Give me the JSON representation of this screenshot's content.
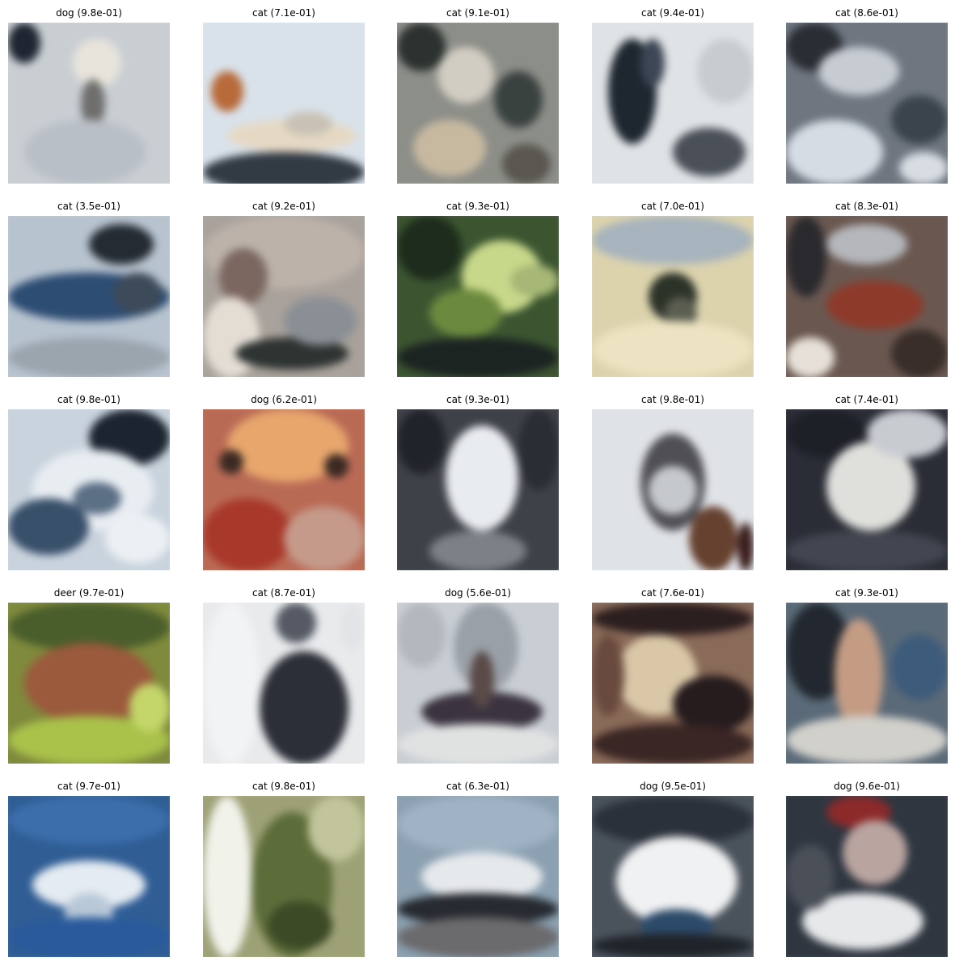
{
  "grid": {
    "rows": 5,
    "cols": 5,
    "images": [
      {
        "label": "dog (9.8e-01)",
        "bg": "#c9ced3",
        "blobs": [
          [
            "#1f2632",
            0,
            0,
            40,
            50
          ],
          [
            "#e8e4dc",
            80,
            20,
            60,
            60
          ],
          [
            "#6e6f6c",
            90,
            70,
            30,
            60
          ],
          [
            "#b9bfc6",
            20,
            120,
            150,
            80
          ]
        ]
      },
      {
        "label": "cat (7.1e-01)",
        "bg": "#d9e2ea",
        "blobs": [
          [
            "#b86a3a",
            10,
            60,
            40,
            50
          ],
          [
            "#e6d9c4",
            30,
            120,
            160,
            40
          ],
          [
            "#323a44",
            0,
            160,
            200,
            50
          ],
          [
            "#c9c2b4",
            100,
            110,
            60,
            30
          ]
        ]
      },
      {
        "label": "cat (9.1e-01)",
        "bg": "#8c8e88",
        "blobs": [
          [
            "#2c3230",
            0,
            0,
            60,
            60
          ],
          [
            "#d2cdc2",
            50,
            30,
            70,
            70
          ],
          [
            "#3a4240",
            120,
            60,
            60,
            70
          ],
          [
            "#c7b9a0",
            20,
            120,
            90,
            70
          ],
          [
            "#5a5650",
            130,
            150,
            60,
            50
          ]
        ]
      },
      {
        "label": "cat (9.4e-01)",
        "bg": "#dfe3e6",
        "blobs": [
          [
            "#1e2630",
            20,
            20,
            60,
            130
          ],
          [
            "#3c4654",
            60,
            20,
            30,
            60
          ],
          [
            "#4a4f58",
            100,
            130,
            90,
            60
          ],
          [
            "#c8ccd0",
            130,
            20,
            70,
            80
          ]
        ]
      },
      {
        "label": "cat (8.6e-01)",
        "bg": "#6f7680",
        "blobs": [
          [
            "#2a2e34",
            0,
            0,
            70,
            60
          ],
          [
            "#c7ccd3",
            40,
            30,
            100,
            60
          ],
          [
            "#d5dce4",
            0,
            120,
            120,
            80
          ],
          [
            "#3b434d",
            130,
            90,
            70,
            60
          ],
          [
            "#d8dde3",
            140,
            160,
            60,
            40
          ]
        ]
      },
      {
        "label": "cat (3.5e-01)",
        "bg": "#b7c3cf",
        "blobs": [
          [
            "#252b33",
            100,
            10,
            80,
            50
          ],
          [
            "#2e4d73",
            0,
            70,
            200,
            60
          ],
          [
            "#3d4a59",
            130,
            70,
            60,
            50
          ],
          [
            "#9aa5ae",
            0,
            150,
            200,
            50
          ]
        ]
      },
      {
        "label": "cat (9.2e-01)",
        "bg": "#a9a19b",
        "blobs": [
          [
            "#bcb2aa",
            0,
            0,
            200,
            90
          ],
          [
            "#7b6760",
            20,
            40,
            60,
            70
          ],
          [
            "#e3ddd4",
            0,
            100,
            70,
            100
          ],
          [
            "#2e3432",
            40,
            150,
            140,
            40
          ],
          [
            "#8a8f95",
            100,
            100,
            90,
            60
          ]
        ]
      },
      {
        "label": "cat (9.3e-01)",
        "bg": "#3c5530",
        "blobs": [
          [
            "#1d2c1c",
            0,
            0,
            80,
            80
          ],
          [
            "#c8d88a",
            80,
            30,
            100,
            90
          ],
          [
            "#6c8a3e",
            40,
            90,
            90,
            60
          ],
          [
            "#1c2422",
            0,
            150,
            200,
            50
          ],
          [
            "#a6b776",
            140,
            60,
            60,
            40
          ]
        ]
      },
      {
        "label": "cat (7.0e-01)",
        "bg": "#dcd3ad",
        "blobs": [
          [
            "#a7b4bd",
            0,
            0,
            200,
            60
          ],
          [
            "#2b3328",
            70,
            70,
            60,
            60
          ],
          [
            "#5b5e50",
            90,
            100,
            40,
            40
          ],
          [
            "#ebe3c1",
            0,
            130,
            200,
            70
          ]
        ]
      },
      {
        "label": "cat (8.3e-01)",
        "bg": "#6a5850",
        "blobs": [
          [
            "#2a2a2e",
            0,
            0,
            50,
            100
          ],
          [
            "#b5b7bc",
            50,
            10,
            100,
            50
          ],
          [
            "#8e3a2a",
            50,
            80,
            120,
            60
          ],
          [
            "#e6e0d8",
            0,
            150,
            60,
            50
          ],
          [
            "#3a2e2a",
            130,
            140,
            70,
            60
          ]
        ]
      },
      {
        "label": "cat (9.8e-01)",
        "bg": "#c9d3dd",
        "blobs": [
          [
            "#1c2430",
            100,
            0,
            100,
            70
          ],
          [
            "#e8edf2",
            30,
            50,
            150,
            100
          ],
          [
            "#39506b",
            0,
            110,
            100,
            70
          ],
          [
            "#5b6f85",
            80,
            90,
            60,
            40
          ],
          [
            "#ecf0f4",
            120,
            130,
            80,
            60
          ]
        ]
      },
      {
        "label": "dog (6.2e-01)",
        "bg": "#b96a55",
        "blobs": [
          [
            "#e7a66c",
            30,
            0,
            150,
            90
          ],
          [
            "#3b2a22",
            20,
            50,
            30,
            30
          ],
          [
            "#3b2a22",
            150,
            55,
            30,
            30
          ],
          [
            "#a8382a",
            0,
            110,
            110,
            90
          ],
          [
            "#c59a8a",
            100,
            120,
            100,
            80
          ]
        ]
      },
      {
        "label": "cat (9.3e-01)",
        "bg": "#3e4148",
        "blobs": [
          [
            "#21232a",
            0,
            0,
            60,
            80
          ],
          [
            "#e9ecef",
            60,
            20,
            90,
            130
          ],
          [
            "#2a2d34",
            150,
            0,
            50,
            100
          ],
          [
            "#7d8187",
            40,
            150,
            120,
            50
          ]
        ]
      },
      {
        "label": "cat (9.8e-01)",
        "bg": "#dfe2e6",
        "blobs": [
          [
            "#4f4f55",
            60,
            30,
            80,
            120
          ],
          [
            "#c5c8cc",
            70,
            70,
            60,
            60
          ],
          [
            "#66412f",
            120,
            120,
            60,
            80
          ],
          [
            "#3a1c1c",
            180,
            140,
            20,
            60
          ]
        ]
      },
      {
        "label": "cat (7.4e-01)",
        "bg": "#2a2d36",
        "blobs": [
          [
            "#1e2028",
            0,
            0,
            100,
            60
          ],
          [
            "#dfe0dc",
            50,
            40,
            110,
            110
          ],
          [
            "#c8ccd1",
            100,
            0,
            100,
            60
          ],
          [
            "#424650",
            0,
            150,
            200,
            50
          ]
        ]
      },
      {
        "label": "deer (9.7e-01)",
        "bg": "#7f8a3c",
        "blobs": [
          [
            "#4a5e2c",
            0,
            0,
            200,
            60
          ],
          [
            "#9b5a3c",
            20,
            50,
            160,
            100
          ],
          [
            "#a9c24a",
            0,
            140,
            200,
            60
          ],
          [
            "#c4d56a",
            150,
            100,
            50,
            60
          ]
        ]
      },
      {
        "label": "cat (8.7e-01)",
        "bg": "#e8eaec",
        "blobs": [
          [
            "#2c2f38",
            70,
            60,
            110,
            140
          ],
          [
            "#555a64",
            90,
            0,
            50,
            50
          ],
          [
            "#f2f3f4",
            0,
            0,
            70,
            200
          ],
          [
            "#e2e4e7",
            170,
            0,
            30,
            60
          ]
        ]
      },
      {
        "label": "dog (5.6e-01)",
        "bg": "#c9ced4",
        "blobs": [
          [
            "#9aa0a8",
            70,
            0,
            80,
            110
          ],
          [
            "#3b3440",
            30,
            110,
            150,
            50
          ],
          [
            "#5a4a48",
            90,
            60,
            30,
            70
          ],
          [
            "#e0e2e2",
            0,
            150,
            200,
            50
          ],
          [
            "#b3b8be",
            0,
            0,
            60,
            80
          ]
        ]
      },
      {
        "label": "cat (7.6e-01)",
        "bg": "#8a6a58",
        "blobs": [
          [
            "#2c1f1f",
            0,
            0,
            200,
            40
          ],
          [
            "#d9c7a7",
            30,
            40,
            100,
            100
          ],
          [
            "#261c1e",
            100,
            90,
            100,
            70
          ],
          [
            "#3a2624",
            0,
            150,
            200,
            50
          ],
          [
            "#6a4a3e",
            0,
            40,
            40,
            100
          ]
        ]
      },
      {
        "label": "cat (9.3e-01)",
        "bg": "#5a6a78",
        "blobs": [
          [
            "#232830",
            0,
            0,
            80,
            120
          ],
          [
            "#c49c84",
            60,
            20,
            60,
            140
          ],
          [
            "#3d5b7b",
            130,
            40,
            70,
            80
          ],
          [
            "#d1d0cb",
            0,
            140,
            200,
            60
          ]
        ]
      },
      {
        "label": "cat (9.7e-01)",
        "bg": "#2f5d94",
        "blobs": [
          [
            "#3c6eab",
            0,
            0,
            200,
            60
          ],
          [
            "#e4ebf2",
            30,
            80,
            140,
            60
          ],
          [
            "#b9c8d8",
            70,
            120,
            60,
            50
          ],
          [
            "#2a5a9c",
            0,
            150,
            200,
            50
          ]
        ]
      },
      {
        "label": "cat (9.8e-01)",
        "bg": "#9ea176",
        "blobs": [
          [
            "#f1f2ea",
            0,
            0,
            60,
            200
          ],
          [
            "#5d6d3a",
            60,
            20,
            100,
            180
          ],
          [
            "#c2c59b",
            130,
            0,
            70,
            80
          ],
          [
            "#3d4a26",
            80,
            130,
            80,
            60
          ]
        ]
      },
      {
        "label": "cat (6.3e-01)",
        "bg": "#8ba0b1",
        "blobs": [
          [
            "#9fb3c4",
            0,
            0,
            200,
            70
          ],
          [
            "#e6e9ec",
            30,
            70,
            150,
            60
          ],
          [
            "#272b31",
            0,
            120,
            200,
            40
          ],
          [
            "#6b6a6c",
            0,
            150,
            200,
            50
          ]
        ]
      },
      {
        "label": "dog (9.5e-01)",
        "bg": "#4a525c",
        "blobs": [
          [
            "#2b313a",
            0,
            0,
            200,
            60
          ],
          [
            "#f0f1f2",
            30,
            50,
            150,
            110
          ],
          [
            "#2c4b6a",
            60,
            140,
            90,
            40
          ],
          [
            "#20242a",
            0,
            170,
            200,
            30
          ]
        ]
      },
      {
        "label": "dog (9.6e-01)",
        "bg": "#2f3640",
        "blobs": [
          [
            "#8c2a2a",
            50,
            0,
            80,
            40
          ],
          [
            "#b9a4a0",
            70,
            30,
            80,
            80
          ],
          [
            "#e6e8ea",
            20,
            120,
            150,
            70
          ],
          [
            "#4a4f58",
            0,
            60,
            60,
            80
          ]
        ]
      }
    ]
  }
}
